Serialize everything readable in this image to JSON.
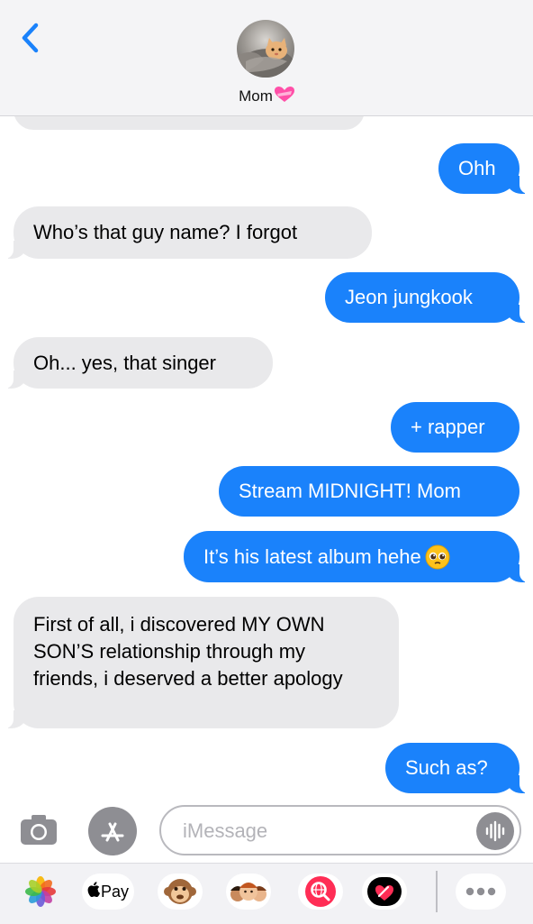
{
  "header": {
    "back_label": "Back",
    "contact_name": "Mom",
    "contact_emoji": "heart-with-ribbon"
  },
  "messages": [
    {
      "side": "in",
      "text": ""
    },
    {
      "side": "out",
      "text": "Ohh"
    },
    {
      "side": "in",
      "text": "Who’s that guy name? I forgot"
    },
    {
      "side": "out",
      "text": "Jeon jungkook"
    },
    {
      "side": "in",
      "text": "Oh... yes, that singer"
    },
    {
      "side": "out",
      "text": "+ rapper"
    },
    {
      "side": "out",
      "text": "Stream MIDNIGHT! Mom"
    },
    {
      "side": "out",
      "text": "It’s his latest album hehe"
    },
    {
      "side": "in",
      "text": "First of all, i discovered MY OWN SON’S relationship through my friends, i deserved a better apology"
    },
    {
      "side": "out",
      "text": "Such as?"
    }
  ],
  "composer": {
    "placeholder": "iMessage",
    "value": ""
  },
  "apps": {
    "apple_pay_label": "Pay",
    "icons": [
      "photos-icon",
      "apple-pay-icon",
      "monkey-animoji-icon",
      "memoji-icon",
      "image-search-icon",
      "digital-touch-icon",
      "more-apps-icon"
    ]
  },
  "colors": {
    "accent": "#1a82fb",
    "incoming_bubble": "#e9e9eb",
    "outgoing_bubble": "#1a82fb"
  }
}
